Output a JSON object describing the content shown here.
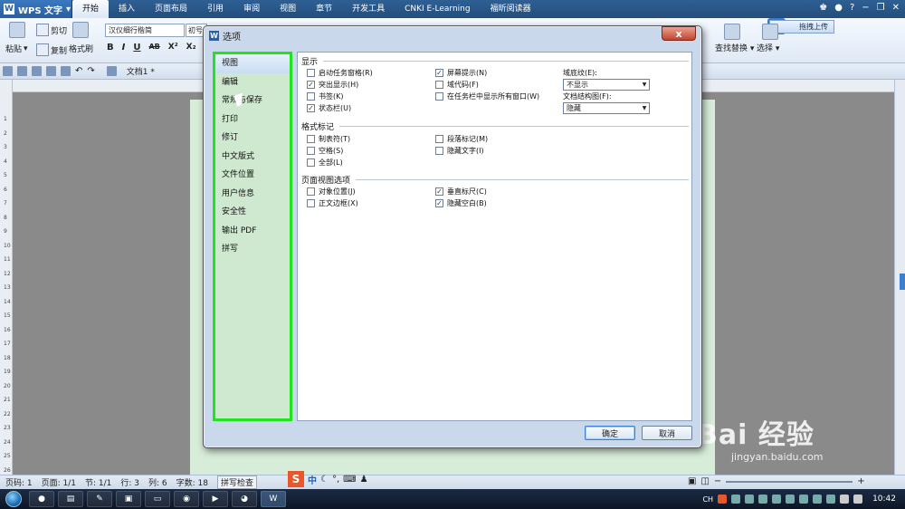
{
  "app": {
    "name": "WPS 文字",
    "menu_tabs": [
      "开始",
      "插入",
      "页面布局",
      "引用",
      "审阅",
      "视图",
      "章节",
      "开发工具",
      "CNKI E-Learning",
      "福昕阅读器"
    ],
    "active_tab": "开始"
  },
  "ribbon": {
    "paste": "粘贴",
    "cut": "剪切",
    "copy": "复制",
    "format_painter": "格式刷",
    "font_name": "汉仪细行楷简",
    "font_size": "初号",
    "upload": "拖拽上传",
    "find_replace": "查找替换",
    "select": "选择",
    "format_bold": "B",
    "format_italic": "I",
    "format_underline": "U",
    "format_strike": "AB",
    "format_super": "X²",
    "format_sub": "X₂"
  },
  "quick_access": {
    "doc_tab": "文档1 *"
  },
  "dialog": {
    "title": "选项",
    "close": "x",
    "nav_items": [
      "视图",
      "编辑",
      "常规与保存",
      "打印",
      "修订",
      "中文版式",
      "文件位置",
      "用户信息",
      "安全性",
      "输出 PDF",
      "拼写"
    ],
    "section_display": "显示",
    "section_format_marks": "格式标记",
    "section_page_view": "页面视图选项",
    "checkboxes": {
      "task_pane": {
        "label": "启动任务窗格(R)",
        "checked": false
      },
      "highlight": {
        "label": "突出显示(H)",
        "checked": true
      },
      "bookmark": {
        "label": "书签(K)",
        "checked": false
      },
      "status_bar": {
        "label": "状态栏(U)",
        "checked": true
      },
      "screen_tips": {
        "label": "屏幕提示(N)",
        "checked": true
      },
      "field_codes": {
        "label": "域代码(F)",
        "checked": false
      },
      "show_taskbar": {
        "label": "在任务栏中显示所有窗口(W)",
        "checked": false
      },
      "tab_chars": {
        "label": "制表符(T)",
        "checked": false
      },
      "spaces": {
        "label": "空格(S)",
        "checked": false
      },
      "all": {
        "label": "全部(L)",
        "checked": false
      },
      "paragraph": {
        "label": "段落标记(M)",
        "checked": false
      },
      "hidden_text": {
        "label": "隐藏文字(I)",
        "checked": false
      },
      "object_anchor": {
        "label": "对象位置(J)",
        "checked": false
      },
      "text_boundary": {
        "label": "正文边框(X)",
        "checked": false
      },
      "vertical_ruler": {
        "label": "垂直标尺(C)",
        "checked": true
      },
      "hide_whitespace": {
        "label": "隐藏空白(B)",
        "checked": true
      }
    },
    "field_shading_label": "域底纹(E):",
    "field_shading_value": "不显示",
    "doc_map_label": "文档结构图(F):",
    "doc_map_value": "隐藏",
    "ok": "确定",
    "cancel": "取消"
  },
  "statusbar": {
    "page_num": "页码: 1",
    "page": "页面: 1/1",
    "section": "节: 1/1",
    "row": "行: 3",
    "col": "列: 6",
    "words": "字数: 18",
    "spell": "拼写检查",
    "zoom_minus": "−",
    "zoom_plus": "+"
  },
  "ime": {
    "logo": "S",
    "mode": "中"
  },
  "taskbar": {
    "time": "10:42",
    "lang": "CH"
  },
  "watermark": {
    "brand": "Bai 经验",
    "url": "jingyan.baidu.com"
  },
  "ruler_numbers": [
    "1",
    "2",
    "3",
    "4",
    "5",
    "6",
    "7",
    "8",
    "9",
    "10",
    "11",
    "12",
    "13",
    "14",
    "15",
    "16",
    "17",
    "18",
    "19",
    "20",
    "21",
    "22",
    "23",
    "24",
    "25",
    "26"
  ]
}
